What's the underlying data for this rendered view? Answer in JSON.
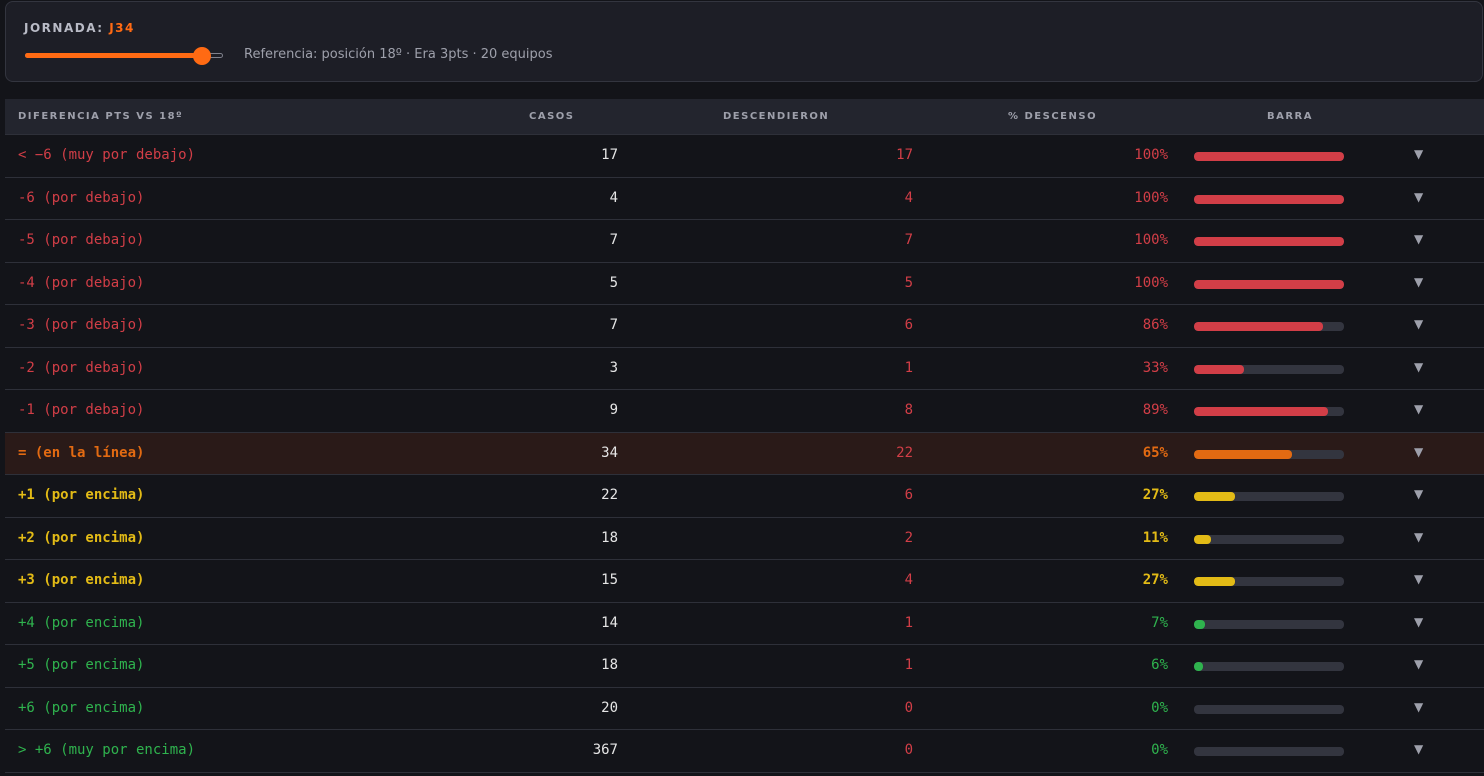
{
  "header": {
    "jornada_label": "JORNADA:",
    "jornada_value": "J34",
    "slider_value": 34,
    "slider_max": 38,
    "reference_text": "Referencia: posición 18º · Era 3pts · 20 equipos"
  },
  "columns": {
    "diff": "DIFERENCIA PTS VS 18º",
    "casos": "CASOS",
    "descendieron": "DESCENDIERON",
    "pct": "% DESCENSO",
    "barra": "BARRA"
  },
  "colors": {
    "accent": "#ff6a13",
    "red": "#d23e47",
    "orange": "#e26a12",
    "yellow": "#e3bb16",
    "green": "#2fb34e",
    "desc_number": "#d23e47"
  },
  "chevron_icon": "▼",
  "rows": [
    {
      "label": "< −6 (muy por debajo)",
      "casos": "17",
      "descendieron": "17",
      "pct": "100%",
      "fraction": 1.0,
      "tone": "red"
    },
    {
      "label": "-6 (por debajo)",
      "casos": "4",
      "descendieron": "4",
      "pct": "100%",
      "fraction": 1.0,
      "tone": "red"
    },
    {
      "label": "-5 (por debajo)",
      "casos": "7",
      "descendieron": "7",
      "pct": "100%",
      "fraction": 1.0,
      "tone": "red"
    },
    {
      "label": "-4 (por debajo)",
      "casos": "5",
      "descendieron": "5",
      "pct": "100%",
      "fraction": 1.0,
      "tone": "red"
    },
    {
      "label": "-3 (por debajo)",
      "casos": "7",
      "descendieron": "6",
      "pct": "86%",
      "fraction": 0.86,
      "tone": "red"
    },
    {
      "label": "-2 (por debajo)",
      "casos": "3",
      "descendieron": "1",
      "pct": "33%",
      "fraction": 0.33,
      "tone": "red"
    },
    {
      "label": "-1 (por debajo)",
      "casos": "9",
      "descendieron": "8",
      "pct": "89%",
      "fraction": 0.89,
      "tone": "red"
    },
    {
      "label": "= (en la línea)",
      "casos": "34",
      "descendieron": "22",
      "pct": "65%",
      "fraction": 0.65,
      "tone": "orange",
      "highlight": true
    },
    {
      "label": "+1 (por encima)",
      "casos": "22",
      "descendieron": "6",
      "pct": "27%",
      "fraction": 0.27,
      "tone": "yellow"
    },
    {
      "label": "+2 (por encima)",
      "casos": "18",
      "descendieron": "2",
      "pct": "11%",
      "fraction": 0.11,
      "tone": "yellow"
    },
    {
      "label": "+3 (por encima)",
      "casos": "15",
      "descendieron": "4",
      "pct": "27%",
      "fraction": 0.27,
      "tone": "yellow"
    },
    {
      "label": "+4 (por encima)",
      "casos": "14",
      "descendieron": "1",
      "pct": "7%",
      "fraction": 0.07,
      "tone": "green"
    },
    {
      "label": "+5 (por encima)",
      "casos": "18",
      "descendieron": "1",
      "pct": "6%",
      "fraction": 0.06,
      "tone": "green"
    },
    {
      "label": "+6 (por encima)",
      "casos": "20",
      "descendieron": "0",
      "pct": "0%",
      "fraction": 0.0,
      "tone": "green"
    },
    {
      "label": "> +6 (muy por encima)",
      "casos": "367",
      "descendieron": "0",
      "pct": "0%",
      "fraction": 0.0,
      "tone": "green"
    }
  ]
}
